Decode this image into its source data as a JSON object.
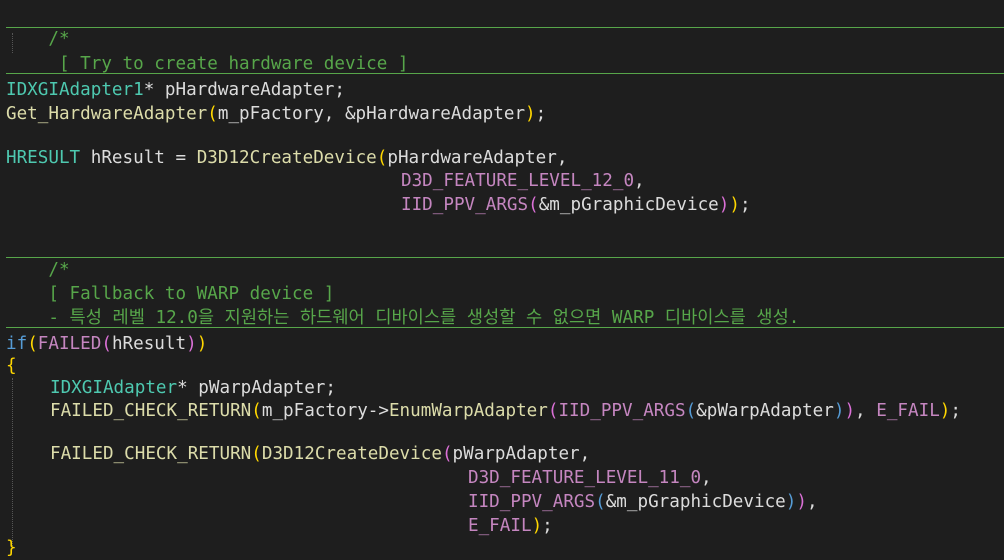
{
  "colors": {
    "background": "#1e1e1e",
    "default_text": "#dcdcdc",
    "comment": "#57a64a",
    "type": "#4ec9b0",
    "function": "#dcdcaa",
    "macro": "#c586c0",
    "keyword": "#569cd6",
    "paren_yellow": "#ffd700",
    "paren_purple": "#da70d6"
  },
  "code": {
    "comment1_open": "/*",
    "comment1_text": "[ Try to create hardware device ]",
    "line_adapter_type": "IDXGIAdapter1",
    "line_adapter_rest": "* pHardwareAdapter;",
    "get_fn": "Get_HardwareAdapter",
    "get_args": "m_pFactory, &pHardwareAdapter",
    "get_end": ";",
    "hresult_type": "HRESULT",
    "hresult_assign": " hResult = ",
    "create_fn": "D3D12CreateDevice",
    "create_arg1": "pHardwareAdapter,",
    "feature_level_12": "D3D_FEATURE_LEVEL_12_0",
    "comma": ",",
    "iid_macro": "IID_PPV_ARGS",
    "iid_arg": "&m_pGraphicDevice",
    "semi": ";",
    "comment2_open": "/*",
    "comment2_text1": "[ Fallback to WARP device ]",
    "comment2_text2": "- 특성 레벨 12.0을 지원하는 하드웨어 디바이스를 생성할 수 없으면 WARP 디바이스를 생성.",
    "if_kw": "if",
    "failed_macro": "FAILED",
    "hresult_var": "hResult",
    "brace_open": "{",
    "warp_type": "IDXGIAdapter",
    "warp_rest": "* pWarpAdapter;",
    "check_macro": "FAILED_CHECK_RETURN",
    "factory_arrow": "m_pFactory->",
    "enum_fn": "EnumWarpAdapter",
    "warp_ref": "&pWarpAdapter",
    "efail": "E_FAIL",
    "warp_arg": "pWarpAdapter,",
    "feature_level_11": "D3D_FEATURE_LEVEL_11_0",
    "brace_close": "}"
  }
}
